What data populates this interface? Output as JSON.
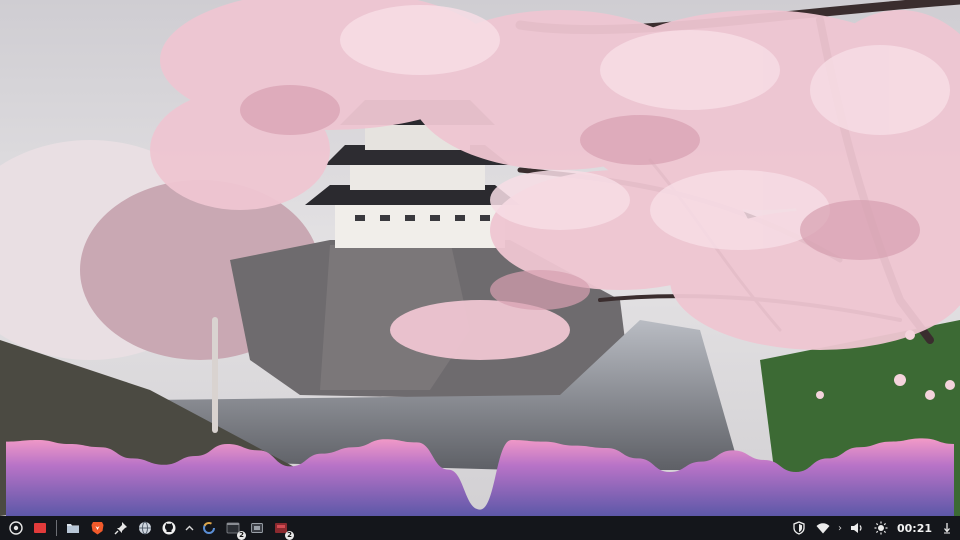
{
  "wallpaper": {
    "description_icon": "cherry-blossom-castle-wallpaper",
    "colors": {
      "sky": "#d8d6d9",
      "blossom": "#f1c9d4",
      "blossom_dark": "#d99fb2",
      "stone": "#6d6a6c",
      "water": "#9fa3ab",
      "grass": "#3f6a33"
    }
  },
  "visualizer": {
    "colors": {
      "top": "#f29ac7",
      "mid": "#b873c7",
      "bottom": "#5d58a8"
    },
    "levels": [
      0.93,
      0.95,
      0.9,
      0.86,
      0.72,
      0.64,
      0.75,
      0.9,
      0.82,
      0.62,
      0.78,
      0.86,
      0.96,
      0.92,
      0.58,
      0.08,
      0.95,
      0.93,
      0.88,
      0.85,
      0.72,
      0.55,
      0.68,
      0.82,
      0.7,
      0.55,
      0.72,
      0.86,
      0.93,
      0.97,
      0.9
    ]
  },
  "taskbar": {
    "left_icons": [
      {
        "name": "launcher-icon",
        "badge": ""
      },
      {
        "name": "show-desktop-icon",
        "badge": ""
      },
      {
        "name": "file-manager-icon",
        "badge": ""
      },
      {
        "name": "brave-browser-icon",
        "badge": ""
      },
      {
        "name": "pin-app-icon",
        "badge": ""
      },
      {
        "name": "network-globe-icon",
        "badge": ""
      },
      {
        "name": "github-icon",
        "badge": ""
      },
      {
        "name": "chevron-up-icon",
        "badge": ""
      },
      {
        "name": "loading-ring-icon",
        "badge": ""
      },
      {
        "name": "terminal-window-icon",
        "badge": "2"
      },
      {
        "name": "app-window-icon",
        "badge": ""
      },
      {
        "name": "red-app-icon",
        "badge": "2"
      }
    ],
    "tray": {
      "chevron": "›",
      "clock": "00:21"
    }
  }
}
